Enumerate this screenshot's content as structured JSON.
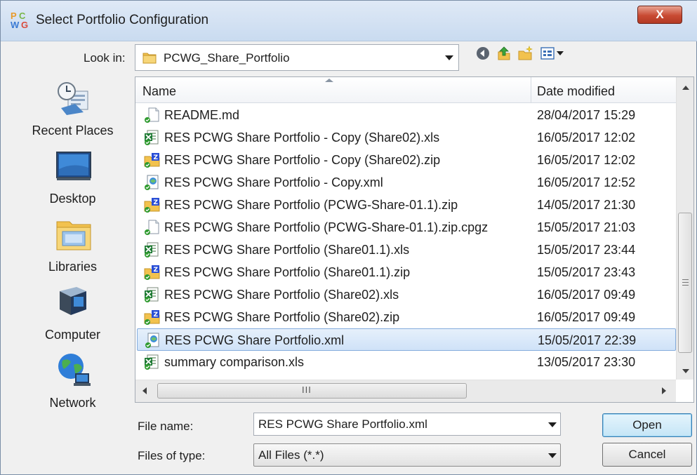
{
  "window": {
    "title": "Select Portfolio Configuration",
    "close_label": "X"
  },
  "lookin": {
    "label": "Look in:",
    "value": "PCWG_Share_Portfolio"
  },
  "places": [
    {
      "label": "Recent Places",
      "icon": "recent-places-icon"
    },
    {
      "label": "Desktop",
      "icon": "desktop-icon"
    },
    {
      "label": "Libraries",
      "icon": "libraries-icon"
    },
    {
      "label": "Computer",
      "icon": "computer-icon"
    },
    {
      "label": "Network",
      "icon": "network-icon"
    }
  ],
  "columns": {
    "name": "Name",
    "date": "Date modified"
  },
  "files": [
    {
      "name": "README.md",
      "date": "28/04/2017 15:29",
      "type": "md"
    },
    {
      "name": "RES PCWG Share Portfolio - Copy (Share02).xls",
      "date": "16/05/2017 12:02",
      "type": "xls"
    },
    {
      "name": "RES PCWG Share Portfolio - Copy (Share02).zip",
      "date": "16/05/2017 12:02",
      "type": "zip"
    },
    {
      "name": "RES PCWG Share Portfolio - Copy.xml",
      "date": "16/05/2017 12:52",
      "type": "xml"
    },
    {
      "name": "RES PCWG Share Portfolio (PCWG-Share-01.1).zip",
      "date": "14/05/2017 21:30",
      "type": "zip"
    },
    {
      "name": "RES PCWG Share Portfolio (PCWG-Share-01.1).zip.cpgz",
      "date": "15/05/2017 21:03",
      "type": "md"
    },
    {
      "name": "RES PCWG Share Portfolio (Share01.1).xls",
      "date": "15/05/2017 23:44",
      "type": "xls"
    },
    {
      "name": "RES PCWG Share Portfolio (Share01.1).zip",
      "date": "15/05/2017 23:43",
      "type": "zip"
    },
    {
      "name": "RES PCWG Share Portfolio (Share02).xls",
      "date": "16/05/2017 09:49",
      "type": "xls"
    },
    {
      "name": "RES PCWG Share Portfolio (Share02).zip",
      "date": "16/05/2017 09:49",
      "type": "zip"
    },
    {
      "name": "RES PCWG Share Portfolio.xml",
      "date": "15/05/2017 22:39",
      "type": "xml",
      "selected": true
    },
    {
      "name": "summary comparison.xls",
      "date": "13/05/2017 23:30",
      "type": "xls"
    }
  ],
  "hscroll_grip": "III",
  "filename": {
    "label": "File name:",
    "value": "RES PCWG Share Portfolio.xml"
  },
  "filetype": {
    "label": "Files of type:",
    "value": "All Files (*.*)"
  },
  "buttons": {
    "open": "Open",
    "cancel": "Cancel"
  },
  "colors": {
    "selection": "#cfe2f8",
    "selection_border": "#84acdd",
    "excel_green": "#1e7b34",
    "zip_blue": "#2a4fd6",
    "folder_yellow": "#f2c24e",
    "check_green": "#2e9a2e"
  }
}
